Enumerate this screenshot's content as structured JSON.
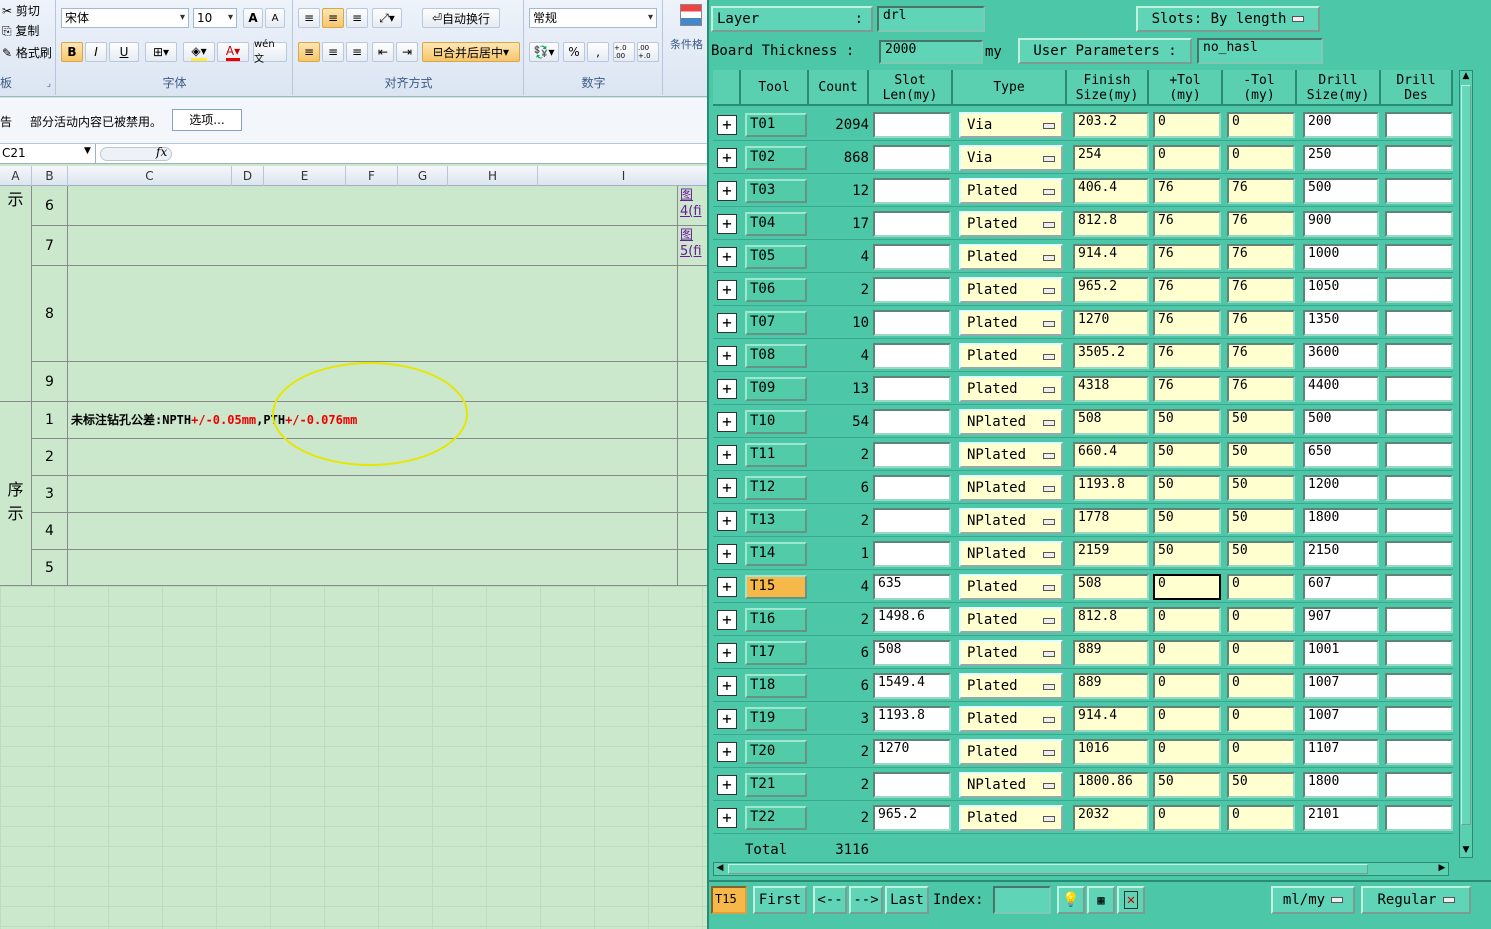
{
  "excel": {
    "clipboard": {
      "cut": "剪切",
      "copy": "复制",
      "format_painter": "格式刷",
      "label": "板"
    },
    "font": {
      "name": "宋体",
      "size": "10",
      "label": "字体",
      "bold": "B",
      "italic": "I",
      "underline": "U",
      "grow": "A",
      "shrink": "A",
      "wen": "wén 文"
    },
    "align": {
      "label": "对齐方式",
      "wrap": "自动换行",
      "merge": "合并后居中"
    },
    "number": {
      "format": "常规",
      "label": "数字",
      "percent": "%",
      "comma": ",",
      "inc": "+.0 .00",
      "dec": ".00 +.0"
    },
    "cond": {
      "label": "条件格"
    },
    "notice": {
      "prefix": "告",
      "text": "部分活动内容已被禁用。",
      "button": "选项..."
    },
    "namebox": "C21",
    "fx": "fx",
    "columns": [
      "A",
      "B",
      "C",
      "D",
      "E",
      "F",
      "G",
      "H",
      "I"
    ],
    "rows": [
      {
        "num": "6"
      },
      {
        "num": "7"
      },
      {
        "num": "8"
      },
      {
        "num": "9"
      },
      {
        "num": "1",
        "content": "未标注钻孔公差:NPTH",
        "red1": "+/-0.05mm",
        ",PTH": ",PTH",
        "red2": "+/-0.076mm"
      },
      {
        "num": "2"
      },
      {
        "num": "3"
      },
      {
        "num": "4"
      },
      {
        "num": "5"
      }
    ],
    "side_a1": "示",
    "side_a2": "序\n示",
    "links": [
      "图",
      "4(fi",
      "图",
      "5(fi"
    ]
  },
  "panel": {
    "layer_label": "Layer",
    "layer_colon": ":",
    "layer_value": "drl",
    "slots_label": "Slots:",
    "slots_value": "By length",
    "thickness_label": "Board Thickness :",
    "thickness_value": "2000",
    "thickness_unit": "my",
    "user_params_label": "User Parameters :",
    "user_params_value": "no_hasl",
    "headers": [
      "Tool",
      "Count",
      "Slot\nLen(my)",
      "Type",
      "Finish\nSize(my)",
      "+Tol\n(my)",
      "-Tol\n(my)",
      "Drill\nSize(my)",
      "Drill\nDes"
    ],
    "rows": [
      {
        "tool": "T01",
        "count": "2094",
        "slot": "",
        "type": "Via",
        "finish": "203.2",
        "ptol": "0",
        "mtol": "0",
        "drill": "200"
      },
      {
        "tool": "T02",
        "count": "868",
        "slot": "",
        "type": "Via",
        "finish": "254",
        "ptol": "0",
        "mtol": "0",
        "drill": "250"
      },
      {
        "tool": "T03",
        "count": "12",
        "slot": "",
        "type": "Plated",
        "finish": "406.4",
        "ptol": "76",
        "mtol": "76",
        "drill": "500"
      },
      {
        "tool": "T04",
        "count": "17",
        "slot": "",
        "type": "Plated",
        "finish": "812.8",
        "ptol": "76",
        "mtol": "76",
        "drill": "900"
      },
      {
        "tool": "T05",
        "count": "4",
        "slot": "",
        "type": "Plated",
        "finish": "914.4",
        "ptol": "76",
        "mtol": "76",
        "drill": "1000"
      },
      {
        "tool": "T06",
        "count": "2",
        "slot": "",
        "type": "Plated",
        "finish": "965.2",
        "ptol": "76",
        "mtol": "76",
        "drill": "1050"
      },
      {
        "tool": "T07",
        "count": "10",
        "slot": "",
        "type": "Plated",
        "finish": "1270",
        "ptol": "76",
        "mtol": "76",
        "drill": "1350"
      },
      {
        "tool": "T08",
        "count": "4",
        "slot": "",
        "type": "Plated",
        "finish": "3505.2",
        "ptol": "76",
        "mtol": "76",
        "drill": "3600"
      },
      {
        "tool": "T09",
        "count": "13",
        "slot": "",
        "type": "Plated",
        "finish": "4318",
        "ptol": "76",
        "mtol": "76",
        "drill": "4400"
      },
      {
        "tool": "T10",
        "count": "54",
        "slot": "",
        "type": "NPlated",
        "finish": "508",
        "ptol": "50",
        "mtol": "50",
        "drill": "500"
      },
      {
        "tool": "T11",
        "count": "2",
        "slot": "",
        "type": "NPlated",
        "finish": "660.4",
        "ptol": "50",
        "mtol": "50",
        "drill": "650"
      },
      {
        "tool": "T12",
        "count": "6",
        "slot": "",
        "type": "NPlated",
        "finish": "1193.8",
        "ptol": "50",
        "mtol": "50",
        "drill": "1200"
      },
      {
        "tool": "T13",
        "count": "2",
        "slot": "",
        "type": "NPlated",
        "finish": "1778",
        "ptol": "50",
        "mtol": "50",
        "drill": "1800"
      },
      {
        "tool": "T14",
        "count": "1",
        "slot": "",
        "type": "NPlated",
        "finish": "2159",
        "ptol": "50",
        "mtol": "50",
        "drill": "2150"
      },
      {
        "tool": "T15",
        "count": "4",
        "slot": "635",
        "type": "Plated",
        "finish": "508",
        "ptol": "0",
        "mtol": "0",
        "drill": "607",
        "selected": true
      },
      {
        "tool": "T16",
        "count": "2",
        "slot": "1498.6",
        "type": "Plated",
        "finish": "812.8",
        "ptol": "0",
        "mtol": "0",
        "drill": "907"
      },
      {
        "tool": "T17",
        "count": "6",
        "slot": "508",
        "type": "Plated",
        "finish": "889",
        "ptol": "0",
        "mtol": "0",
        "drill": "1001"
      },
      {
        "tool": "T18",
        "count": "6",
        "slot": "1549.4",
        "type": "Plated",
        "finish": "889",
        "ptol": "0",
        "mtol": "0",
        "drill": "1007"
      },
      {
        "tool": "T19",
        "count": "3",
        "slot": "1193.8",
        "type": "Plated",
        "finish": "914.4",
        "ptol": "0",
        "mtol": "0",
        "drill": "1007"
      },
      {
        "tool": "T20",
        "count": "2",
        "slot": "1270",
        "type": "Plated",
        "finish": "1016",
        "ptol": "0",
        "mtol": "0",
        "drill": "1107"
      },
      {
        "tool": "T21",
        "count": "2",
        "slot": "",
        "type": "NPlated",
        "finish": "1800.86",
        "ptol": "50",
        "mtol": "50",
        "drill": "1800"
      },
      {
        "tool": "T22",
        "count": "2",
        "slot": "965.2",
        "type": "Plated",
        "finish": "2032",
        "ptol": "0",
        "mtol": "0",
        "drill": "2101"
      }
    ],
    "total_label": "Total",
    "total_value": "3116",
    "footer": {
      "current": "T15",
      "first": "First",
      "prev": "<--",
      "next": "-->",
      "last": "Last",
      "index_label": "Index:",
      "units": "ml/my",
      "mode": "Regular"
    }
  }
}
